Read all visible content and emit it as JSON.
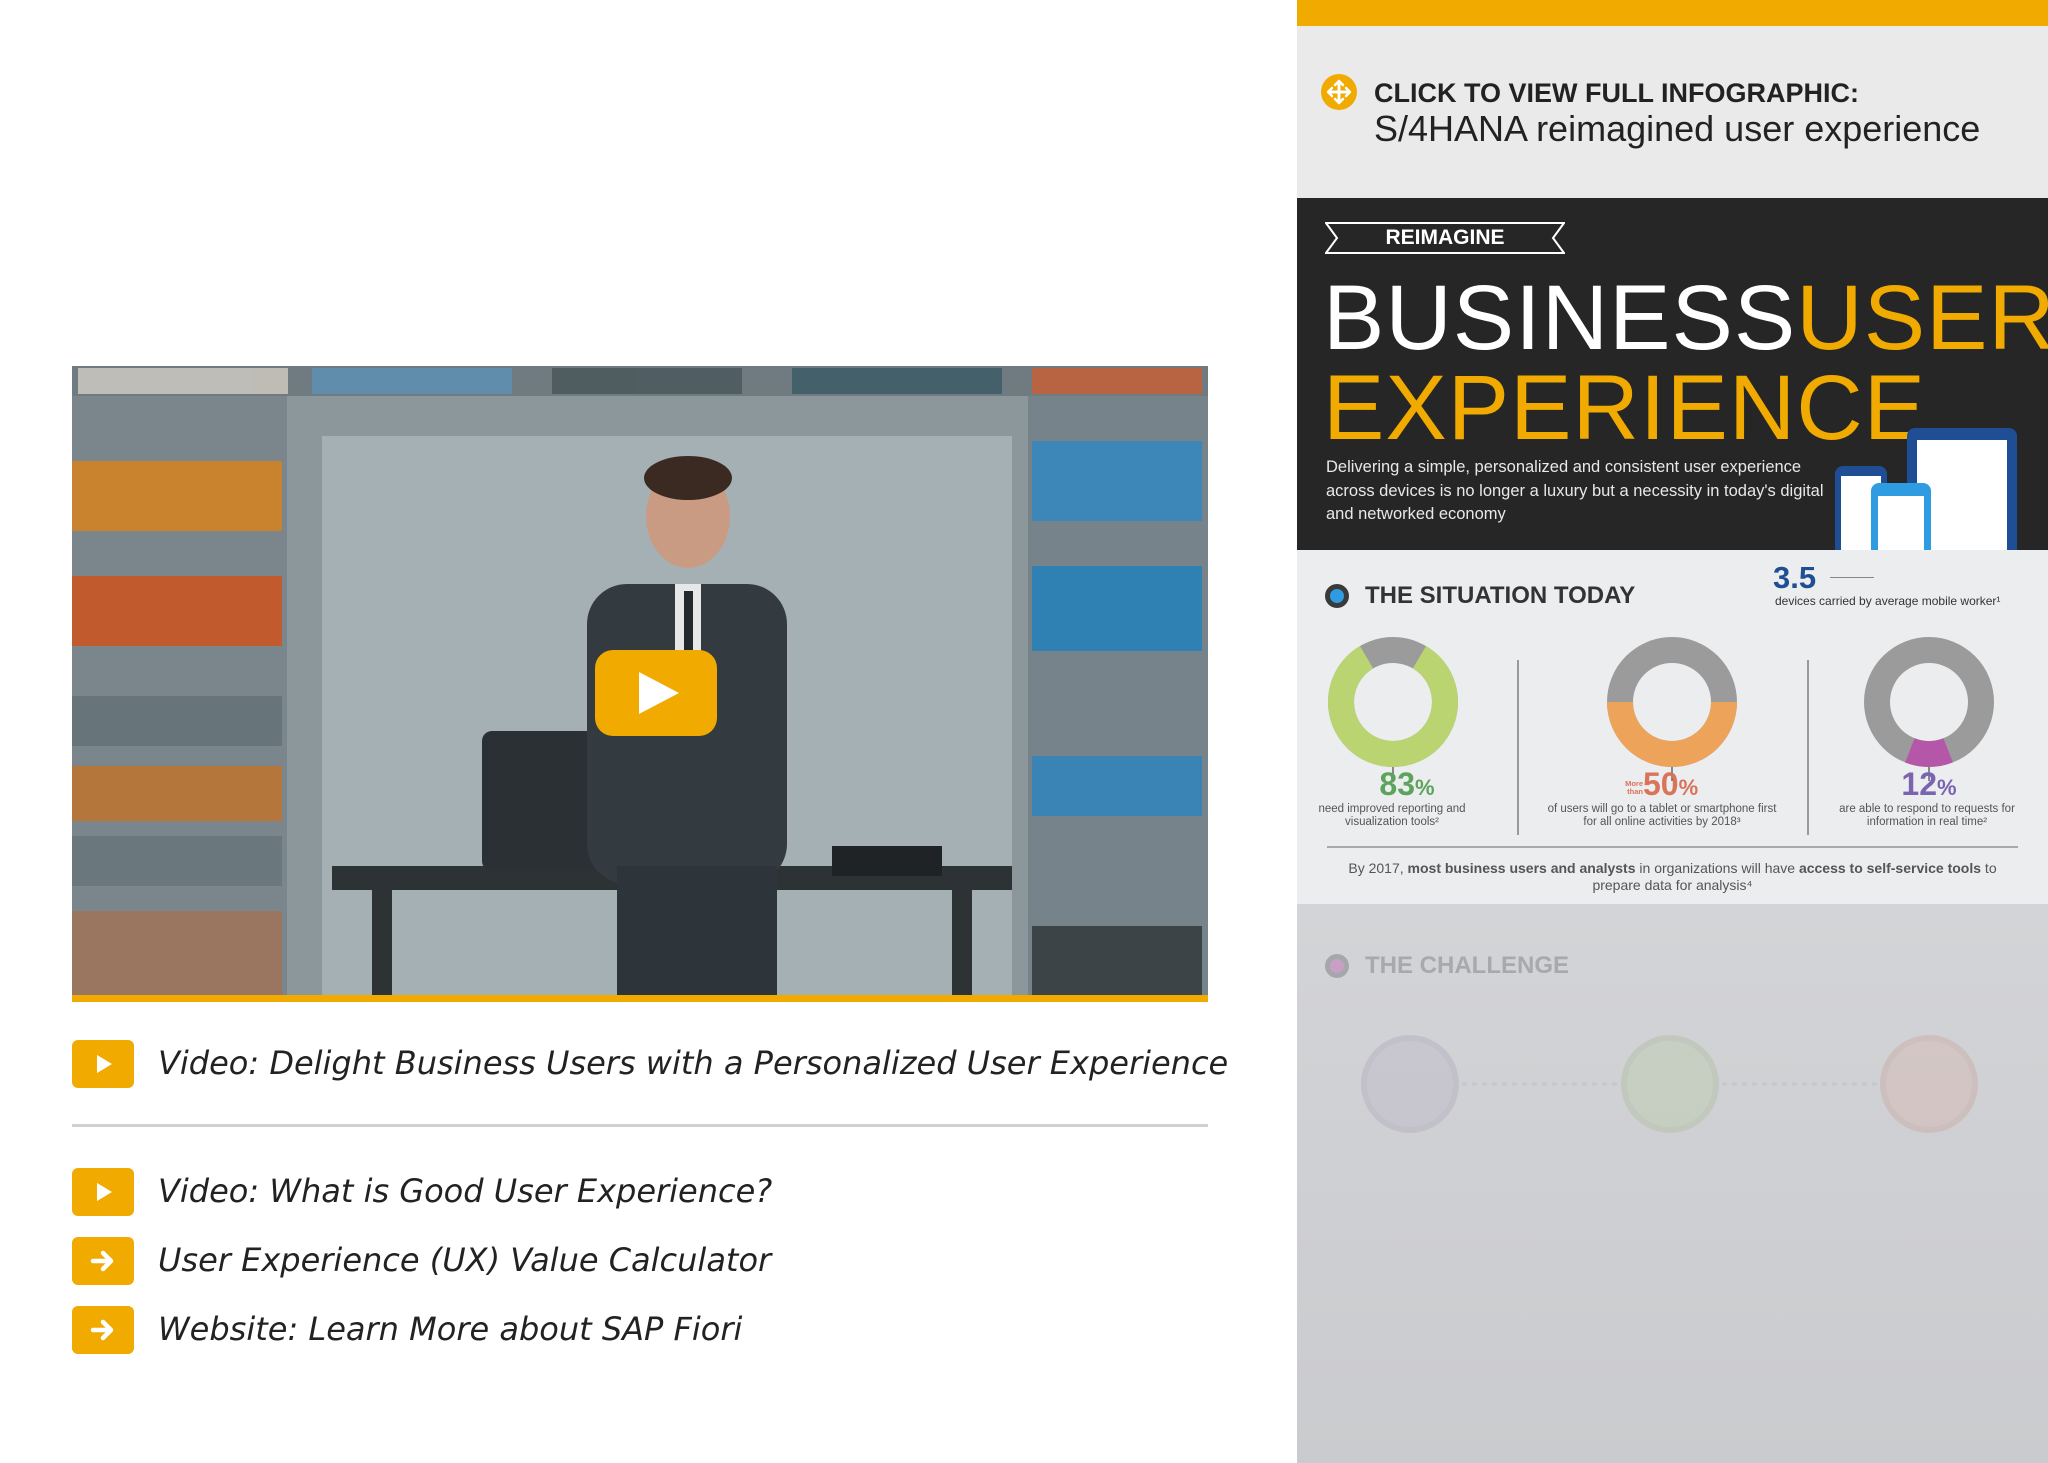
{
  "colors": {
    "accent": "#f0aa00",
    "hero_bg": "#262626",
    "stat1": "#b9d471",
    "stat2": "#eea35b",
    "stat3": "#b557a8",
    "stat_gray": "#9b9b9b",
    "device_blue": "#1f4e95",
    "device_light_blue": "#2f9be0"
  },
  "video": {
    "play_icon": "play-icon"
  },
  "links": [
    {
      "icon": "play-icon",
      "label": "Video: Delight Business Users with a Personalized User Experience"
    },
    {
      "icon": "play-icon",
      "label": "Video: What is Good User Experience?"
    },
    {
      "icon": "arrow-right-icon",
      "label": "User Experience (UX) Value Calculator"
    },
    {
      "icon": "arrow-right-icon",
      "label": "Website: Learn More about SAP Fiori"
    }
  ],
  "infographic": {
    "cta_icon": "expand-icon",
    "cta_title": "CLICK TO VIEW FULL INFOGRAPHIC:",
    "cta_subtitle": "S/4HANA reimagined user experience",
    "banner": "REIMAGINE",
    "title_word1": "BUSINESS",
    "title_word2": "USER",
    "title_word3": "EXPERIENCE",
    "description": "Delivering a simple, personalized and consistent user experience across devices is no longer a luxury but a necessity in today's digital and networked economy",
    "devices_value": "3.5",
    "devices_label": "devices carried by average mobile worker¹",
    "situation_title": "THE SITUATION TODAY",
    "stats": [
      {
        "prefix": "",
        "value": "83",
        "unit": "%",
        "fraction": 0.83,
        "desc": "need improved reporting and visualization tools²"
      },
      {
        "prefix": "More than",
        "value": "50",
        "unit": "%",
        "fraction": 0.5,
        "desc": "of users will go to a tablet or smartphone first for all online activities by 2018³"
      },
      {
        "prefix": "",
        "value": "12",
        "unit": "%",
        "fraction": 0.12,
        "desc": "are able to respond to requests for information in real time²"
      }
    ],
    "note_plain1": "By 2017, ",
    "note_bold1": "most business users and analysts",
    "note_plain2": " in organizations will have ",
    "note_bold2": "access to self-service tools",
    "note_plain3": " to prepare data for analysis⁴",
    "challenge_title": "THE CHALLENGE"
  }
}
